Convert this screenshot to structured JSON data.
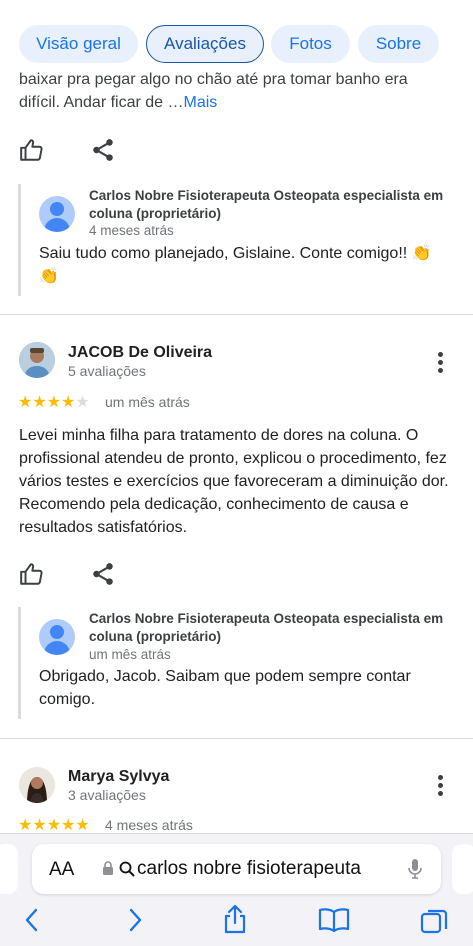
{
  "tabs": [
    {
      "label": "Visão geral",
      "active": false
    },
    {
      "label": "Avaliações",
      "active": true
    },
    {
      "label": "Fotos",
      "active": false
    },
    {
      "label": "Sobre",
      "active": false
    }
  ],
  "review0": {
    "text_line1": "baixar pra pegar algo no chão até pra tomar banho era",
    "text_line2": "difícil. Andar ficar de …",
    "more_label": "Mais",
    "reply": {
      "owner_line1": "Carlos Nobre Fisioterapeuta Osteopata especialista em",
      "owner_line2": "coluna (proprietário)",
      "time": "4 meses atrás",
      "text_line1": "Saiu tudo como planejado, Gislaine. Conte comigo!! 👏",
      "text_line2": "👏"
    }
  },
  "review1": {
    "name": "JACOB De Oliveira",
    "count": "5 avaliações",
    "rating": 4,
    "time": "um mês atrás",
    "text_lines": [
      "Levei minha filha para tratamento de dores na coluna. O",
      "profissional atendeu de pronto, explicou o procedimento, fez",
      "vários testes e exercícios que favoreceram a diminuição dor.",
      "Recomendo pela dedicação, conhecimento de causa e",
      "resultados satisfatórios."
    ],
    "reply": {
      "owner_line1": "Carlos Nobre Fisioterapeuta Osteopata especialista em",
      "owner_line2": "coluna (proprietário)",
      "time": "um mês atrás",
      "text_line1": "Obrigado, Jacob. Saibam que podem sempre contar",
      "text_line2": "comigo."
    }
  },
  "review2": {
    "name": "Marya Sylvya",
    "count": "3 avaliações",
    "rating": 5,
    "time": "4 meses atrás"
  },
  "browser": {
    "aa_label": "AA",
    "url": "carlos nobre fisioterapeuta"
  },
  "colors": {
    "accent": "#1a73e8",
    "star": "#fbbc04"
  }
}
